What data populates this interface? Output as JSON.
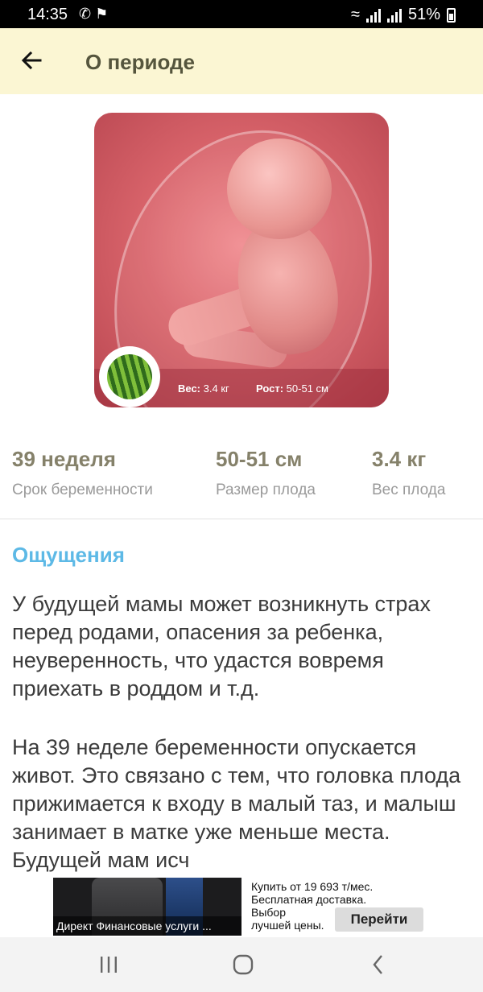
{
  "status_bar": {
    "time": "14:35",
    "notification_icons": [
      "whatsapp-icon",
      "notification-icon"
    ],
    "battery": "51%"
  },
  "app_bar": {
    "title": "О периоде",
    "back_icon": "arrow-left-icon"
  },
  "hero": {
    "weight_label": "Вес:",
    "weight_value": "3.4 кг",
    "height_label": "Рост:",
    "height_value": "50-51 см",
    "fruit_icon": "watermelon-icon"
  },
  "stats": [
    {
      "value": "39 неделя",
      "label": "Срок беременности"
    },
    {
      "value": "50-51 см",
      "label": "Размер плода"
    },
    {
      "value": "3.4 кг",
      "label": "Вес плода"
    }
  ],
  "article": {
    "section_title": "Ощущения",
    "paragraph_1": "У будущей мамы может возникнуть страх перед родами, опасения за ребенка, неуверенность, что удастся вовремя приехать в роддом и т.д.",
    "paragraph_2": "На 39 неделе беременности опускается живот. Это связано с тем, что головка плода прижимается к входу в малый таз, и малыш занимает в матке уже меньше места. Будущей мам исч"
  },
  "ad": {
    "caption": "Директ  Финансовые услуги ...",
    "line_1": "Купить от 19 693 т/мес.",
    "line_2": "Бесплатная доставка.",
    "line_3": "Выбор",
    "line_4": "лучшей цены.",
    "button_label": "Перейти"
  },
  "nav_bar": {
    "recents_icon": "recents-icon",
    "home_icon": "home-icon",
    "back_icon": "back-chevron-icon"
  }
}
